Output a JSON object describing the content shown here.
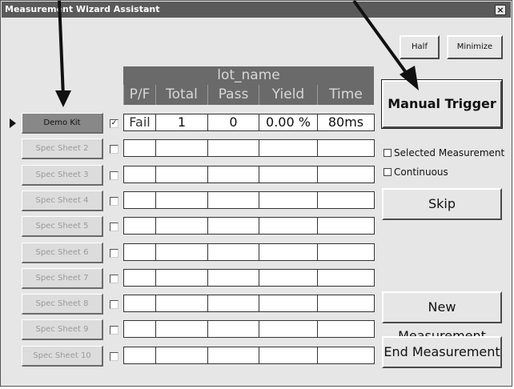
{
  "window": {
    "title": "Measurement Wizard Assistant",
    "close_glyph": "×"
  },
  "table": {
    "lot_name": "lot_name",
    "columns": [
      "P/F",
      "Total",
      "Pass",
      "Yield",
      "Time"
    ],
    "rows": [
      {
        "sheet": "Demo Kit",
        "checked": true,
        "pf": "Fail",
        "total": "1",
        "pass": "0",
        "yield": "0.00 %",
        "time": "80ms"
      },
      {
        "sheet": "Spec Sheet 2",
        "checked": false,
        "pf": "",
        "total": "",
        "pass": "",
        "yield": "",
        "time": ""
      },
      {
        "sheet": "Spec Sheet 3",
        "checked": false,
        "pf": "",
        "total": "",
        "pass": "",
        "yield": "",
        "time": ""
      },
      {
        "sheet": "Spec Sheet 4",
        "checked": false,
        "pf": "",
        "total": "",
        "pass": "",
        "yield": "",
        "time": ""
      },
      {
        "sheet": "Spec Sheet 5",
        "checked": false,
        "pf": "",
        "total": "",
        "pass": "",
        "yield": "",
        "time": ""
      },
      {
        "sheet": "Spec Sheet 6",
        "checked": false,
        "pf": "",
        "total": "",
        "pass": "",
        "yield": "",
        "time": ""
      },
      {
        "sheet": "Spec Sheet 7",
        "checked": false,
        "pf": "",
        "total": "",
        "pass": "",
        "yield": "",
        "time": ""
      },
      {
        "sheet": "Spec Sheet 8",
        "checked": false,
        "pf": "",
        "total": "",
        "pass": "",
        "yield": "",
        "time": ""
      },
      {
        "sheet": "Spec Sheet 9",
        "checked": false,
        "pf": "",
        "total": "",
        "pass": "",
        "yield": "",
        "time": ""
      },
      {
        "sheet": "Spec Sheet 10",
        "checked": false,
        "pf": "",
        "total": "",
        "pass": "",
        "yield": "",
        "time": ""
      }
    ],
    "active_row": 0
  },
  "buttons": {
    "half": "Half",
    "minimize": "Minimize",
    "manual_trigger": "Manual Trigger",
    "skip": "Skip",
    "new_measurement": "New Measurement",
    "end_measurement": "End Measurement"
  },
  "options": {
    "selected_measurement": {
      "label": "Selected Measurement",
      "checked": false
    },
    "continuous": {
      "label": "Continuous",
      "checked": false
    }
  },
  "colors": {
    "header_bg": "#6a6a6a",
    "window_bg": "#e6e6e6",
    "titlebar_bg": "#5a5a5a"
  }
}
